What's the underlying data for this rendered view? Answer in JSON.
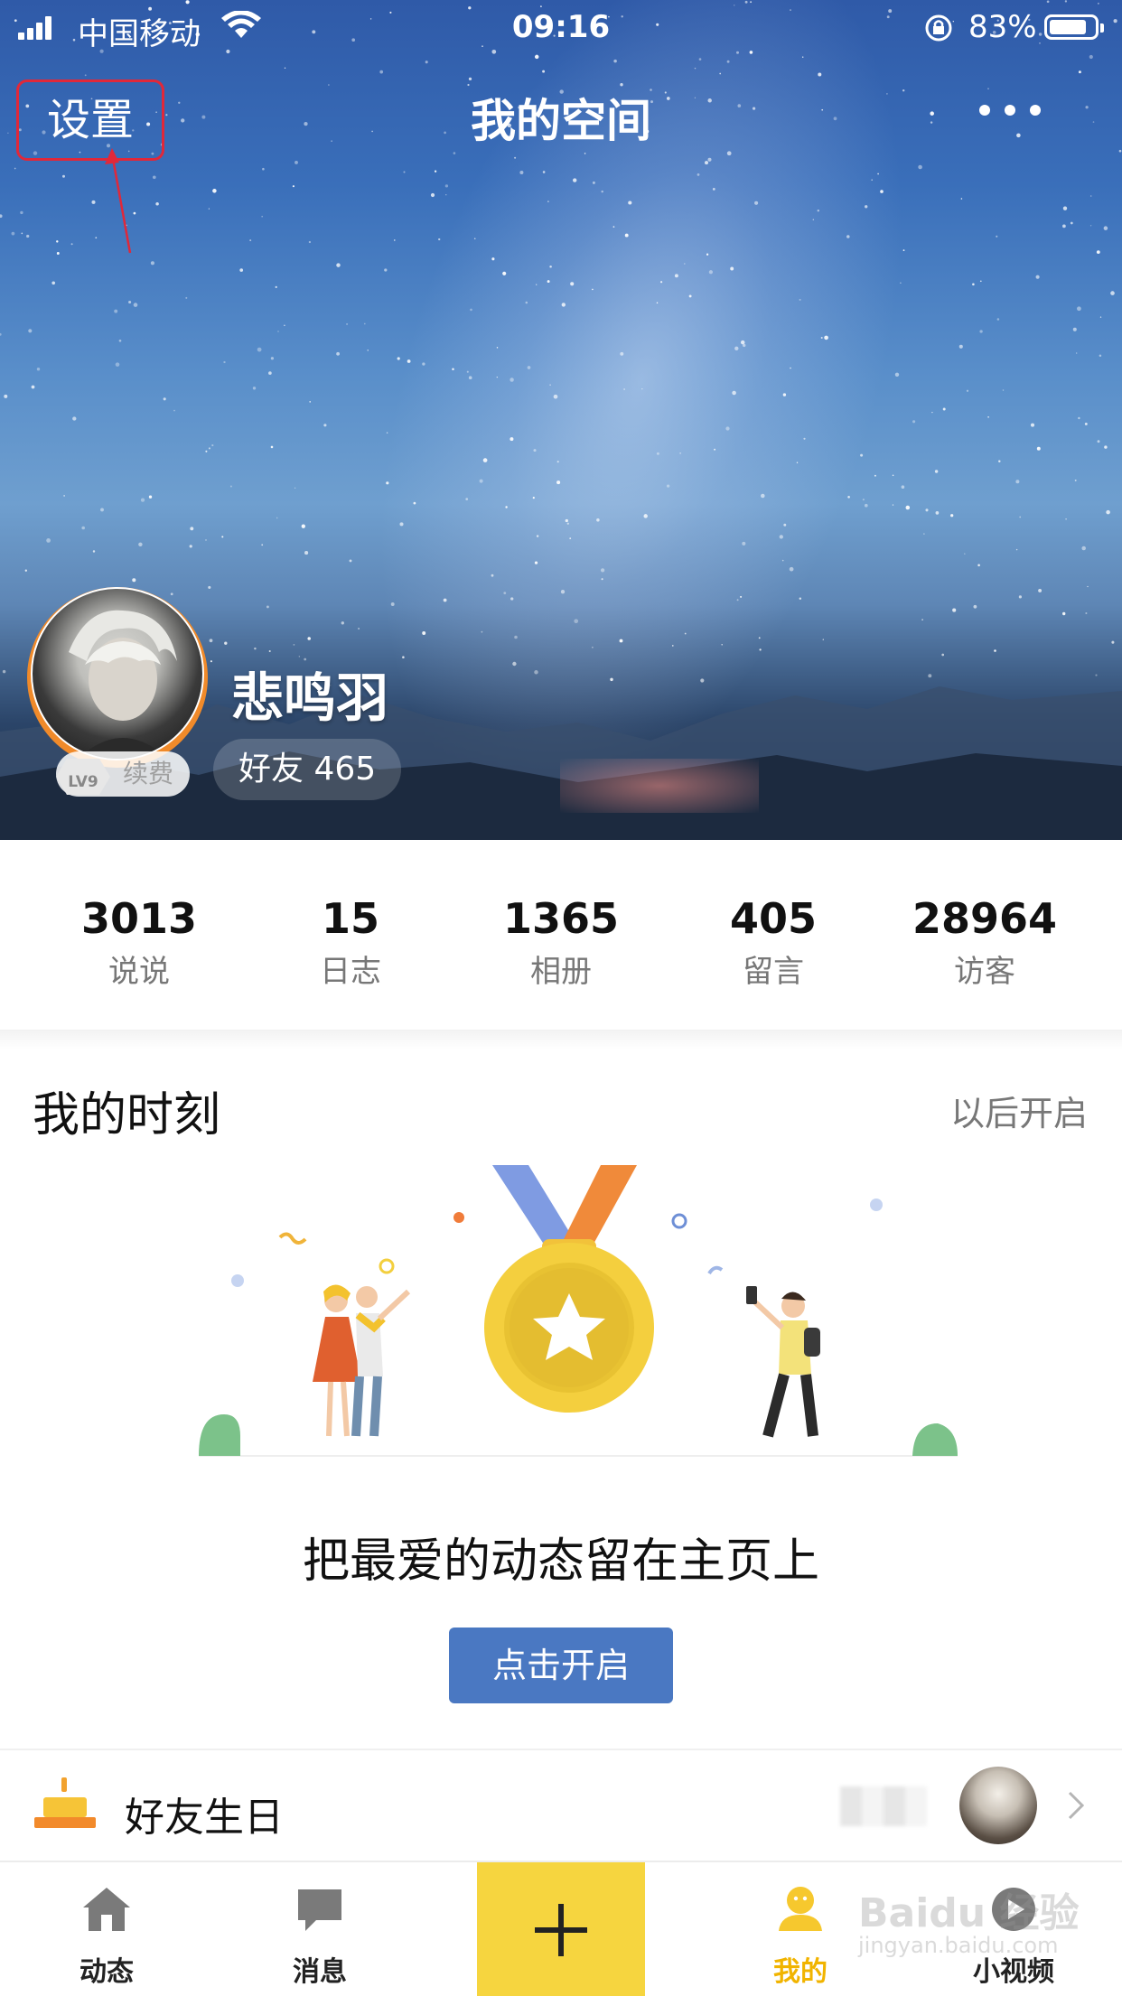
{
  "status_bar": {
    "carrier": "中国移动",
    "time": "09:16",
    "battery_percent": "83%",
    "battery_level": 0.83
  },
  "header": {
    "title": "我的空间",
    "settings_label": "设置",
    "more_icon": "more-dots-icon"
  },
  "profile": {
    "username": "悲鸣羽",
    "friends_label": "好友 465",
    "vip_renew_label": "续费",
    "level_badge": "LV9"
  },
  "stats": [
    {
      "value": "3013",
      "label": "说说"
    },
    {
      "value": "15",
      "label": "日志"
    },
    {
      "value": "1365",
      "label": "相册"
    },
    {
      "value": "405",
      "label": "留言"
    },
    {
      "value": "28964",
      "label": "访客"
    }
  ],
  "moments": {
    "title": "我的时刻",
    "later_label": "以后开启",
    "description": "把最爱的动态留在主页上",
    "enable_button": "点击开启"
  },
  "birthday": {
    "label": "好友生日"
  },
  "tabbar": {
    "tabs": [
      {
        "label": "动态",
        "icon": "home-icon"
      },
      {
        "label": "消息",
        "icon": "message-icon"
      },
      {
        "label": "我的",
        "icon": "profile-icon",
        "active": true
      },
      {
        "label": "小视频",
        "icon": "video-icon"
      }
    ],
    "plus_icon": "plus-icon"
  },
  "watermark": {
    "brand": "Baidu 经验",
    "url": "jingyan.baidu.com"
  },
  "colors": {
    "accent_yellow": "#f6d53f",
    "active_tab": "#f1b400",
    "button_blue": "#4a78c2",
    "annotation_red": "#e0283a"
  }
}
